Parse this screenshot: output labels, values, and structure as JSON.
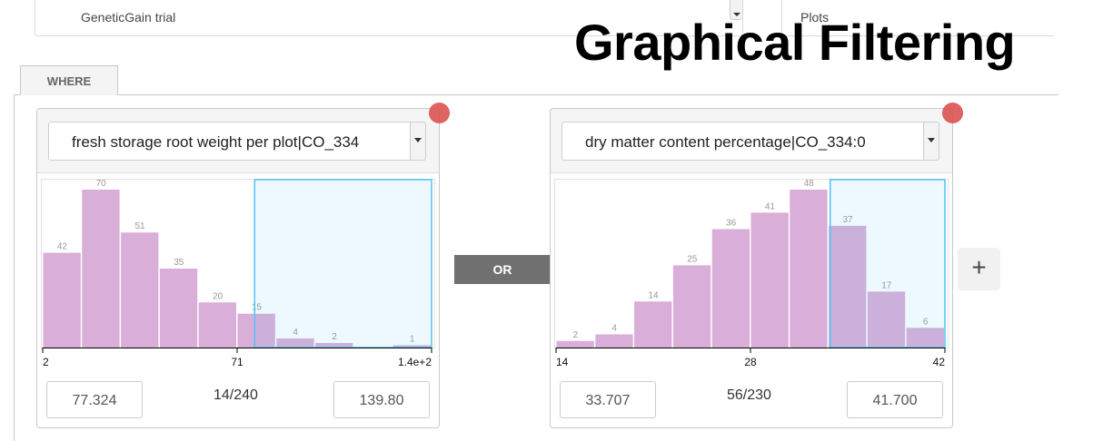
{
  "trial_select": {
    "value": "GeneticGain trial"
  },
  "unit_select": {
    "value": "Plots"
  },
  "overlay_title": "Graphical Filtering",
  "where_tab": {
    "label": "WHERE"
  },
  "or_label": "OR",
  "add_label": "+",
  "colors": {
    "bar": "#d9aed8",
    "brush": "#4fc3f7",
    "remove": "#d9534f",
    "or_bar": "#707070"
  },
  "filters": [
    {
      "trait": "fresh storage root weight per plot|CO_334",
      "min_value": "77.324",
      "max_value": "139.80",
      "count_label": "14/240",
      "axis_ticks": [
        "2",
        "71",
        "1.4e+2"
      ],
      "bins": [
        42,
        70,
        51,
        35,
        20,
        15,
        4,
        2,
        0,
        1
      ],
      "bin_labels": [
        "42",
        "70",
        "51",
        "35",
        "20",
        "15",
        "4",
        "2",
        "",
        "1"
      ],
      "selection_fraction": [
        0.545,
        1.0
      ]
    },
    {
      "trait": "dry matter content percentage|CO_334:0",
      "min_value": "33.707",
      "max_value": "41.700",
      "count_label": "56/230",
      "axis_ticks": [
        "14",
        "28",
        "42"
      ],
      "bins": [
        2,
        4,
        14,
        25,
        36,
        41,
        48,
        37,
        17,
        6
      ],
      "bin_labels": [
        "2",
        "4",
        "14",
        "25",
        "36",
        "41",
        "48",
        "37",
        "17",
        "6"
      ],
      "selection_fraction": [
        0.705,
        1.0
      ]
    }
  ]
}
